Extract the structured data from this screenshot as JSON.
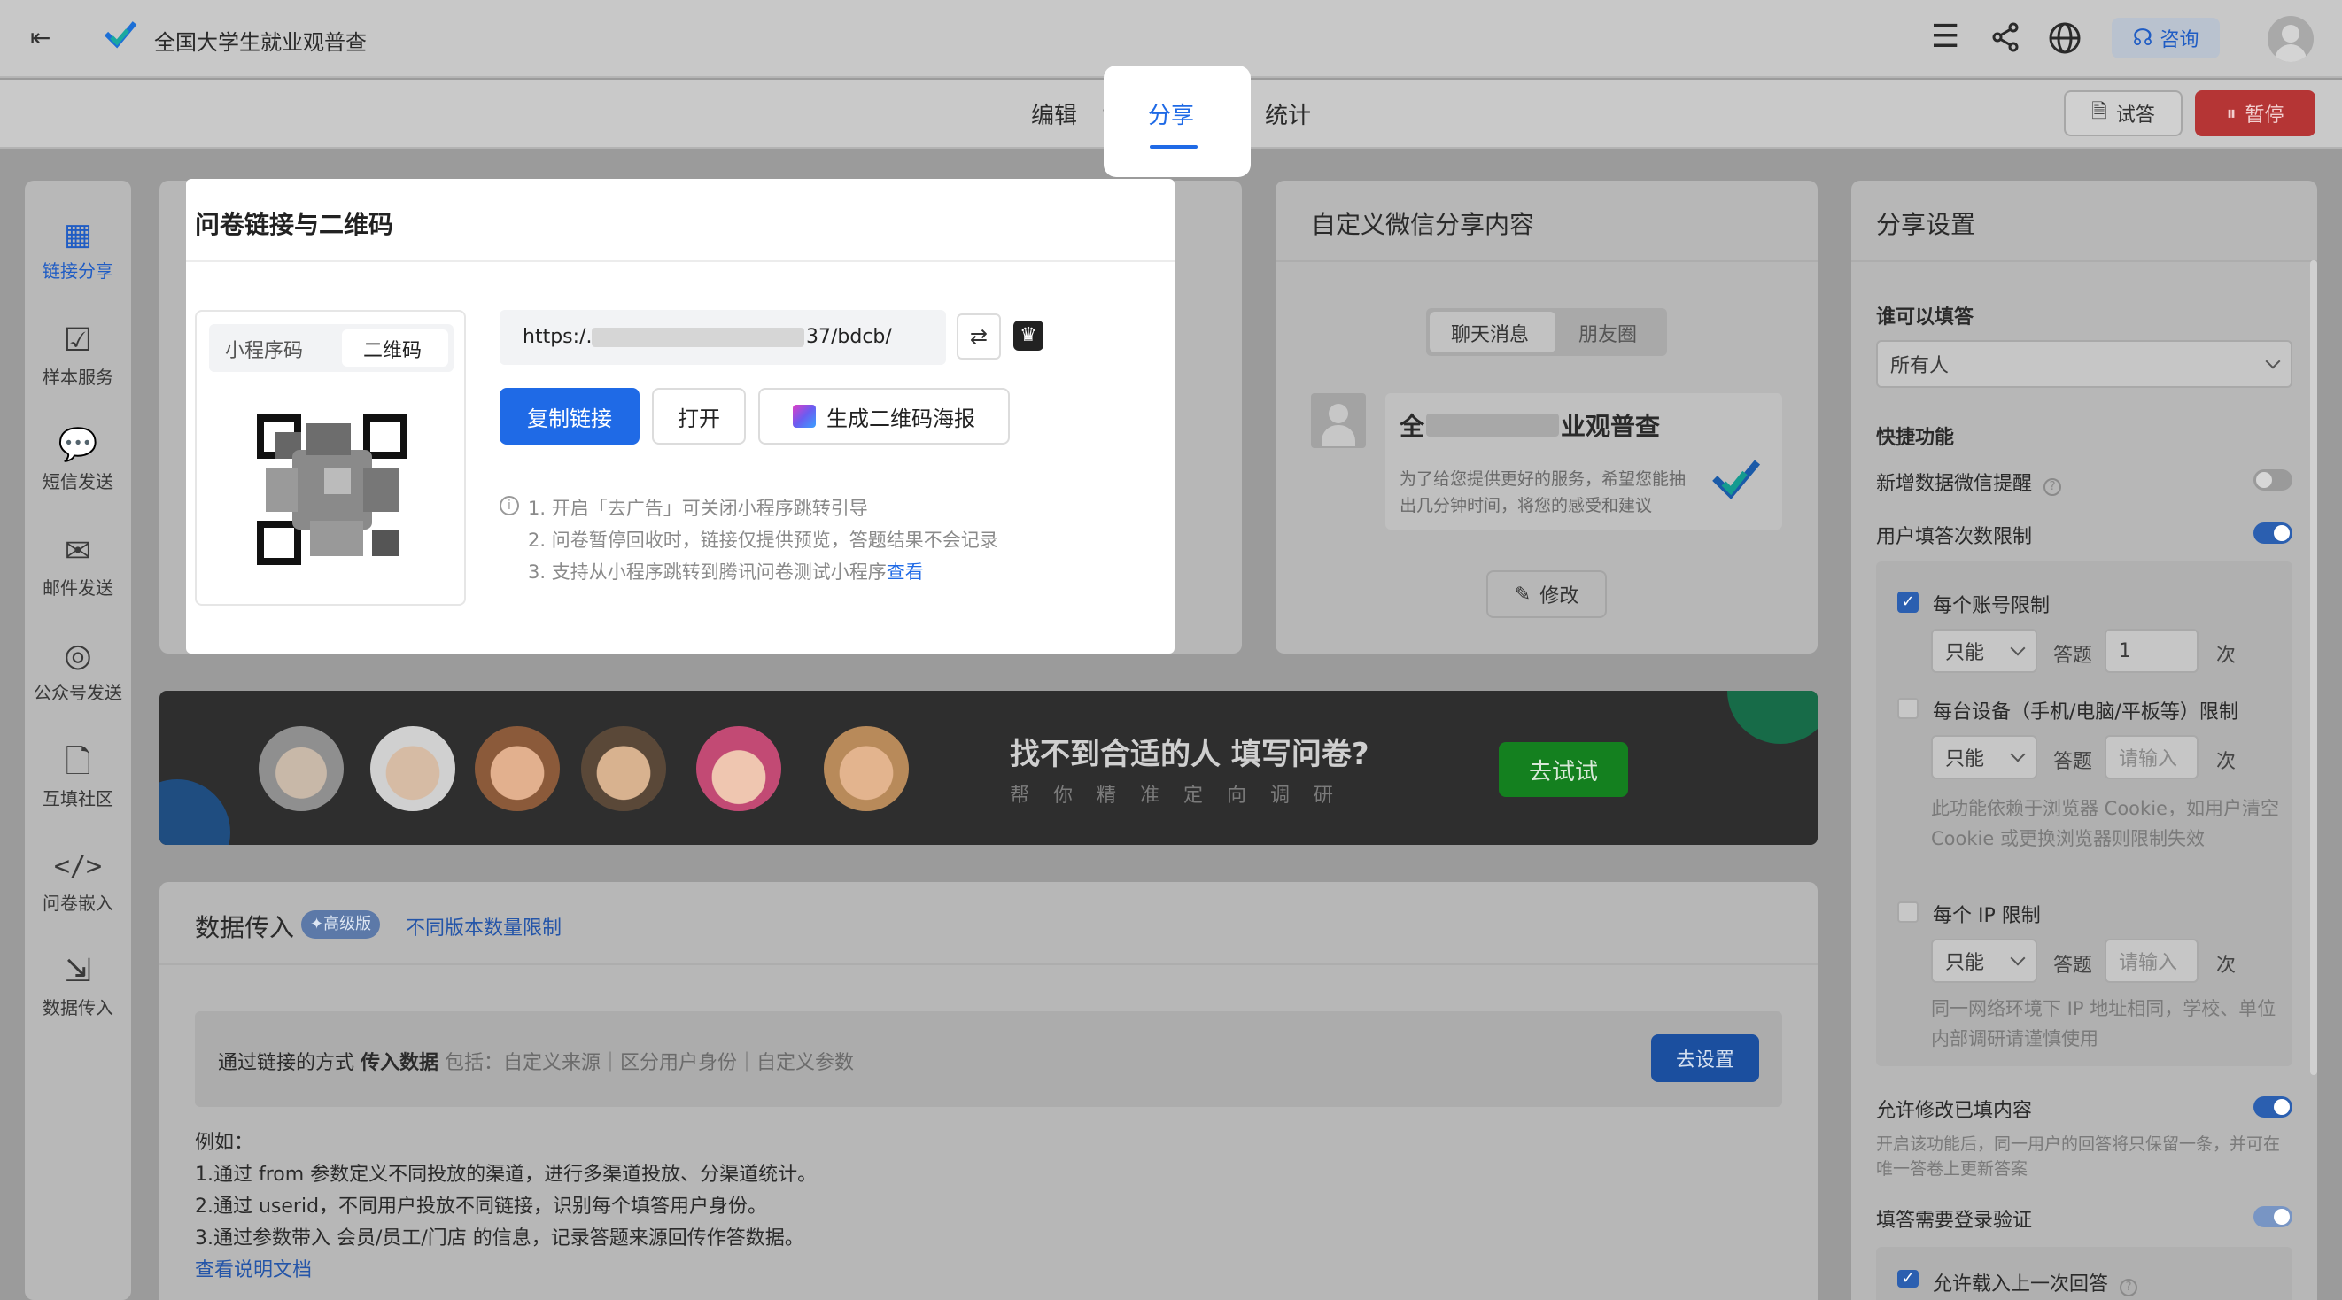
{
  "app": {
    "title": "全国大学生就业观普查",
    "consult": "咨询"
  },
  "nav": {
    "steps": [
      "编辑",
      "分享",
      "统计"
    ],
    "trial": "试答",
    "pause": "暂停"
  },
  "sidebar": {
    "items": [
      {
        "label": "链接分享",
        "icon": "qrcode-icon"
      },
      {
        "label": "样本服务",
        "icon": "check-square-icon"
      },
      {
        "label": "短信发送",
        "icon": "sms-icon"
      },
      {
        "label": "邮件发送",
        "icon": "mail-icon"
      },
      {
        "label": "公众号发送",
        "icon": "wechat-icon"
      },
      {
        "label": "互填社区",
        "icon": "doc-icon"
      },
      {
        "label": "问卷嵌入",
        "icon": "code-icon"
      },
      {
        "label": "数据传入",
        "icon": "import-icon"
      }
    ]
  },
  "share": {
    "title": "问卷链接与二维码",
    "tabs": [
      "小程序码",
      "二维码"
    ],
    "url_prefix": "https:/.",
    "url_suffix": "37/bdcb/",
    "copy": "复制链接",
    "open": "打开",
    "poster": "生成二维码海报",
    "notes": [
      "1. 开启「去广告」可关闭小程序跳转引导",
      "2. 问卷暂停回收时，链接仅提供预览，答题结果不会记录",
      "3. 支持从小程序跳转到腾讯问卷测试小程序"
    ],
    "view": "查看"
  },
  "wechat": {
    "title": "自定义微信分享内容",
    "tabs": [
      "聊天消息",
      "朋友圈"
    ],
    "card_title_left": "全",
    "card_title_right": "业观普查",
    "card_desc": "为了给您提供更好的服务，希望您能抽出几分钟时间，将您的感受和建议",
    "edit": "修改"
  },
  "banner": {
    "headline": "找不到合适的人 填写问卷?",
    "sub": "帮 你 精 准 定 向 调 研",
    "cta": "去试试"
  },
  "data_import": {
    "title": "数据传入",
    "badge": "✦高级版",
    "limit_link": "不同版本数量限制",
    "box_lead": "通过链接的方式",
    "box_bold": "传入数据",
    "box_rest": "包括：自定义来源｜区分用户身份｜自定义参数",
    "setup": "去设置",
    "example_title": "例如：",
    "examples": [
      "1.通过 from 参数定义不同投放的渠道，进行多渠道投放、分渠道统计。",
      "2.通过 userid，不同用户投放不同链接，识别每个填答用户身份。",
      "3.通过参数带入 会员/员工/门店 的信息，记录答题来源回传作答数据。"
    ],
    "doc_link": "查看说明文档"
  },
  "settings": {
    "title": "分享设置",
    "who_label": "谁可以填答",
    "who_value": "所有人",
    "quick_label": "快捷功能",
    "new_data_remind": "新增数据微信提醒",
    "limit_label": "用户填答次数限制",
    "per_account": "每个账号限制",
    "only": "只能",
    "answer": "答题",
    "times": "次",
    "account_count": "1",
    "per_device": "每台设备（手机/电脑/平板等）限制",
    "input_placeholder": "请输入",
    "device_note": "此功能依赖于浏览器 Cookie，如用户清空 Cookie 或更换浏览器则限制失效",
    "per_ip": "每个 IP 限制",
    "ip_note": "同一网络环境下 IP 地址相同，学校、单位内部调研请谨慎使用",
    "allow_modify": "允许修改已填内容",
    "modify_note": "开启该功能后，同一用户的回答将只保留一条，并可在唯一答卷上更新答案",
    "need_login": "填答需要登录验证",
    "load_last": "允许载入上一次回答"
  },
  "colors": {
    "primary": "#1f6ae6",
    "danger": "#e04848",
    "green": "#1aa33a"
  }
}
